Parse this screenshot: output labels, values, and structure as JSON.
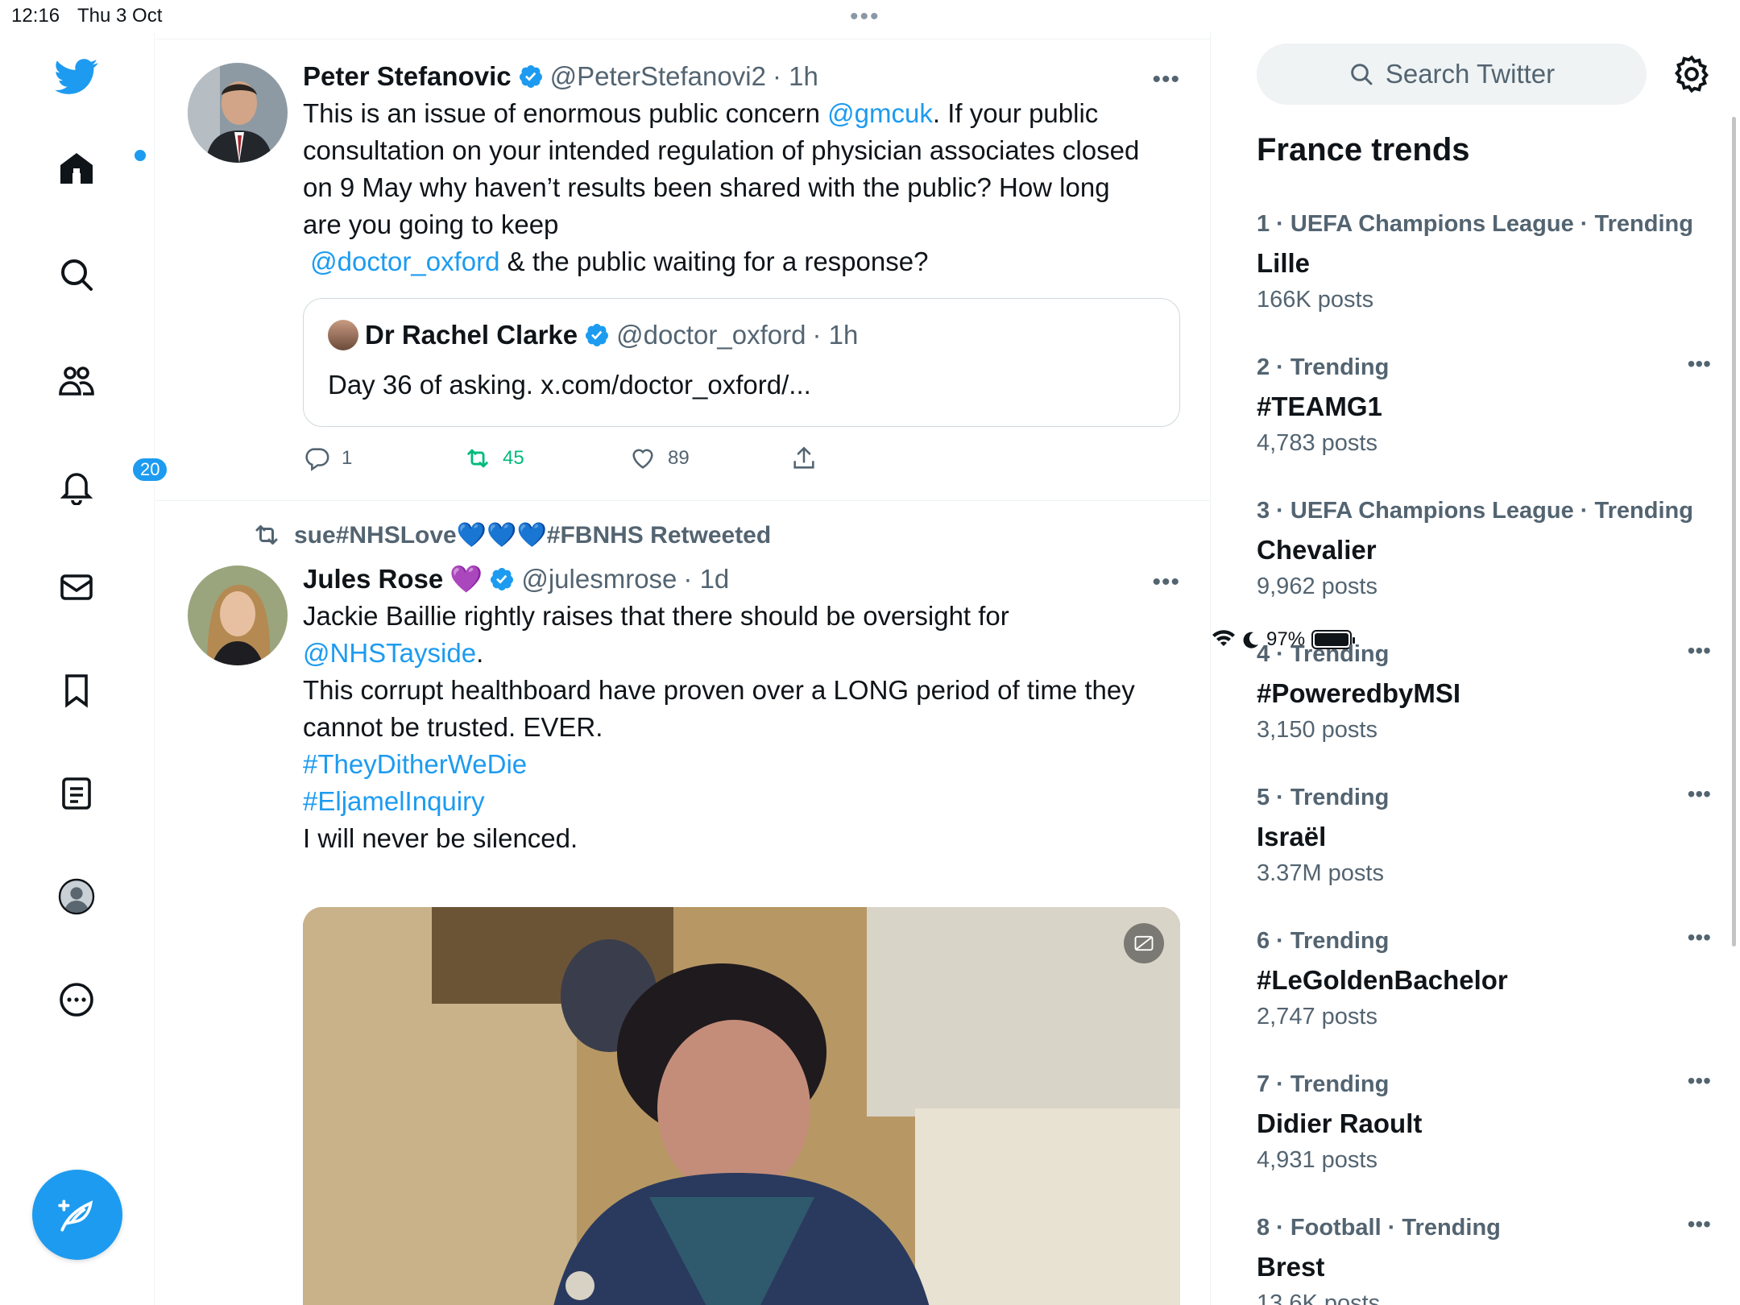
{
  "status_bar": {
    "time": "12:16",
    "date": "Thu 3 Oct",
    "battery": "97%"
  },
  "nav": {
    "notifications_badge": "20"
  },
  "tweets": [
    {
      "name": "Peter Stefanovic",
      "handle": "@PeterStefanovi2",
      "time": "· 1h",
      "line1_pre": "This is an issue of enormous public concern ",
      "line1_link": "@gmcuk",
      "line1_post": ". If your public",
      "line2": "consultation on your intended regulation of physician associates closed",
      "line3": "on 9 May why haven’t results been shared with the public? How long",
      "line4": "are you going to keep",
      "line5_link": "@doctor_oxford",
      "line5_post": " & the public waiting for a response?",
      "quote": {
        "name": "Dr Rachel Clarke",
        "handle": "@doctor_oxford",
        "time": "· 1h",
        "text": "Day 36 of asking. x.com/doctor_oxford/..."
      },
      "replies": "1",
      "retweets": "45",
      "likes": "89"
    },
    {
      "retweeted_by": "sue#NHSLove💙💙💙#FBNHS Retweeted",
      "name": "Jules Rose",
      "name_emoji": "💜",
      "handle": "@julesmrose",
      "time": "· 1d",
      "line1": "Jackie Baillie rightly raises that there should be oversight for",
      "line2_link": "@NHSTayside",
      "line2_post": ".",
      "line3": "This corrupt healthboard have proven over a LONG period of time they",
      "line4": "cannot be trusted. EVER.",
      "line5_link": "#TheyDitherWeDie",
      "line6_link": "#EljamelInquiry",
      "line7": "I will never be silenced."
    }
  ],
  "search": {
    "placeholder": "Search Twitter"
  },
  "trends_title": "France trends",
  "trends": [
    {
      "meta": "1 · UEFA Champions League · Trending",
      "name": "Lille",
      "count": "166K posts"
    },
    {
      "meta": "2 · Trending",
      "name": "#TEAMG1",
      "count": "4,783 posts"
    },
    {
      "meta": "3 · UEFA Champions League · Trending",
      "name": "Chevalier",
      "count": "9,962 posts"
    },
    {
      "meta": "4 · Trending",
      "name": "#PoweredbyMSI",
      "count": "3,150 posts"
    },
    {
      "meta": "5 · Trending",
      "name": "Israël",
      "count": "3.37M posts"
    },
    {
      "meta": "6 · Trending",
      "name": "#LeGoldenBachelor",
      "count": "2,747 posts"
    },
    {
      "meta": "7 · Trending",
      "name": "Didier Raoult",
      "count": "4,931 posts"
    },
    {
      "meta": "8 · Football · Trending",
      "name": "Brest",
      "count": "13.6K posts"
    }
  ],
  "colors": {
    "accent": "#1d9bf0",
    "retweet_green": "#00ba7c",
    "muted": "#536471"
  }
}
